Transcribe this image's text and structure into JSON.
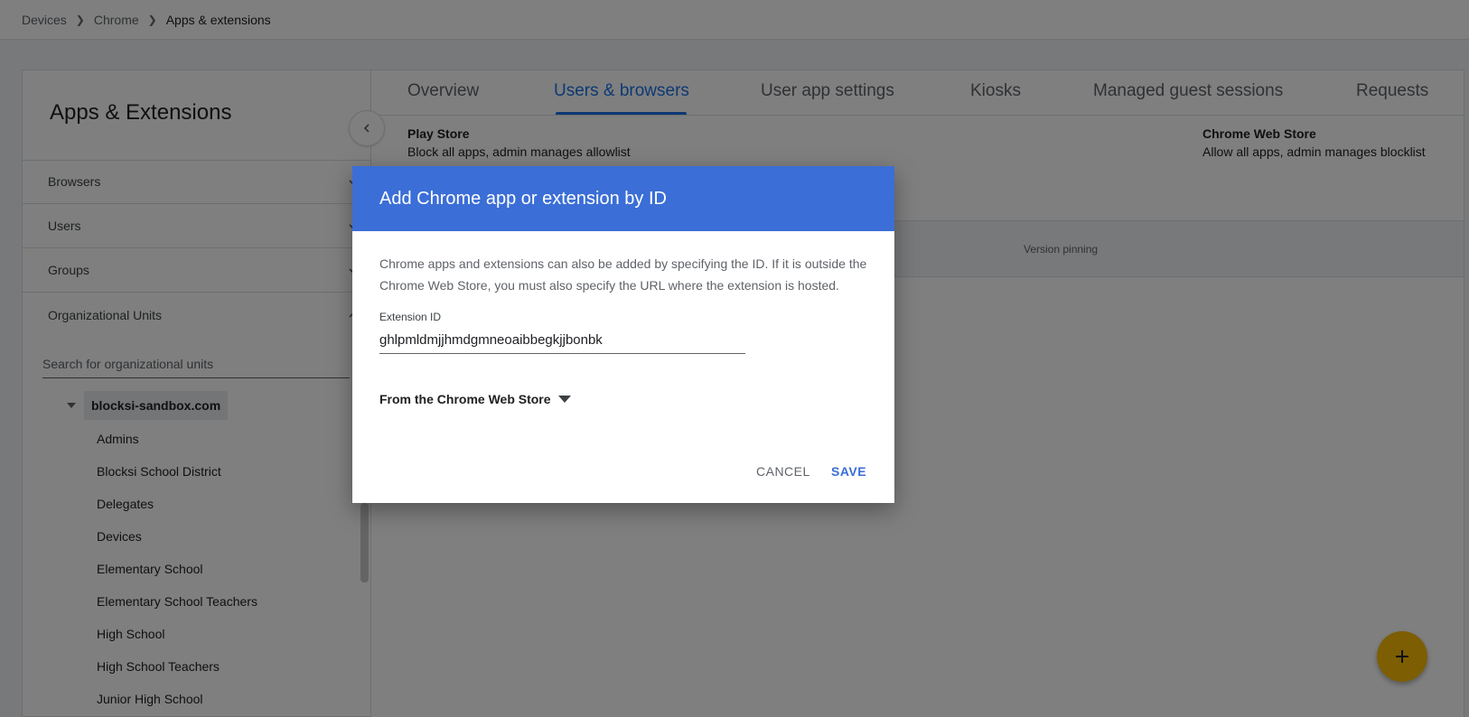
{
  "breadcrumb": {
    "items": [
      "Devices",
      "Chrome",
      "Apps & extensions"
    ]
  },
  "sidebar": {
    "title": "Apps & Extensions",
    "sections": [
      "Browsers",
      "Users",
      "Groups",
      "Organizational Units"
    ],
    "search_placeholder": "Search for organizational units",
    "tree_root": "blocksi-sandbox.com",
    "tree_children": [
      "Admins",
      "Blocksi School District",
      "Delegates",
      "Devices",
      "Elementary School",
      "Elementary School Teachers",
      "High School",
      "High School Teachers",
      "Junior High School"
    ]
  },
  "tabs": [
    "Overview",
    "Users & browsers",
    "User app settings",
    "Kiosks",
    "Managed guest sessions",
    "Requests"
  ],
  "play_store": {
    "title": "Play Store",
    "desc": "Block all apps, admin manages allowlist"
  },
  "web_store": {
    "title": "Chrome Web Store",
    "desc": "Allow all apps, admin manages blocklist"
  },
  "table": {
    "column_version": "Version pinning"
  },
  "dialog": {
    "title": "Add Chrome app or extension by ID",
    "description": "Chrome apps and extensions can also be added by specifying the ID. If it is outside the Chrome Web Store, you must also specify the URL where the extension is hosted.",
    "field_label": "Extension ID",
    "field_value": "ghlpmldmjjhmdgmneoaibbegkjjbonbk",
    "source_option": "From the Chrome Web Store",
    "cancel_label": "CANCEL",
    "save_label": "SAVE"
  },
  "colors": {
    "accent": "#1a73e8",
    "dialog_header": "#3b6ed6",
    "fab": "#fbbc04"
  }
}
